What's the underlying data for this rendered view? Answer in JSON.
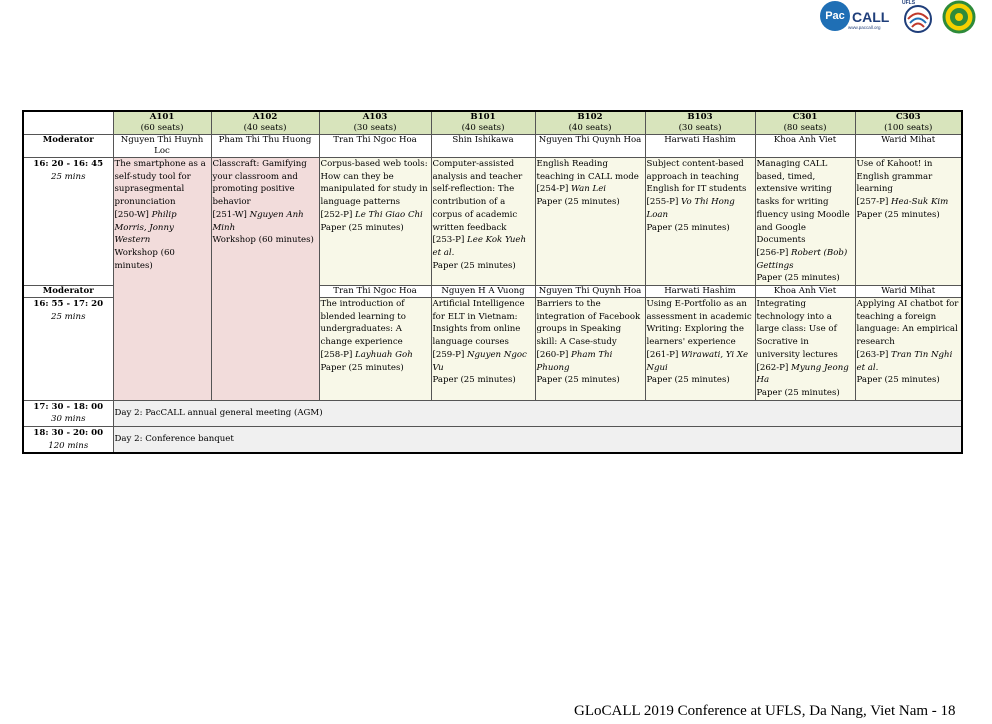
{
  "logos": {
    "paccall_badge": "Pac",
    "paccall_text": "CALL",
    "paccall_url": "www.paccall.org",
    "ufls_label": "UFLS"
  },
  "rooms": [
    {
      "name": "A101",
      "seats": "(60 seats)"
    },
    {
      "name": "A102",
      "seats": "(40 seats)"
    },
    {
      "name": "A103",
      "seats": "(30 seats)"
    },
    {
      "name": "B101",
      "seats": "(40 seats)"
    },
    {
      "name": "B102",
      "seats": "(40 seats)"
    },
    {
      "name": "B103",
      "seats": "(30 seats)"
    },
    {
      "name": "C301",
      "seats": "(80 seats)"
    },
    {
      "name": "C303",
      "seats": "(100 seats)"
    }
  ],
  "moderator_label": "Moderator",
  "session1": {
    "time": "16: 20 - 16: 45",
    "duration": "25 mins",
    "moderators": [
      "Nguyen Thi Huynh Loc",
      "Pham Thi Thu Huong",
      "Tran Thi Ngoc Hoa",
      "Shin Ishikawa",
      "Nguyen Thi Quynh Hoa",
      "Harwati Hashim",
      "Khoa Anh Viet",
      "Warid Mihat"
    ],
    "cells": [
      {
        "title": "The smartphone as a self-study tool for suprasegmental pronunciation",
        "code": "[250-W]",
        "authors": "Philip Morris, Jonny Western",
        "type": "Workshop (60 minutes)"
      },
      {
        "title": "Classcraft: Gamifying your classroom and promoting positive behavior",
        "code": "[251-W]",
        "authors": "Nguyen Anh Minh",
        "type": "Workshop (60 minutes)"
      },
      {
        "title": "Corpus-based web tools: How can they be manipulated for study in language patterns",
        "code": "[252-P]",
        "authors": "Le Thi Giao Chi",
        "type": "Paper (25 minutes)"
      },
      {
        "title": "Computer-assisted analysis and teacher self-reflection: The contribution of a corpus of academic written feedback",
        "code": "[253-P]",
        "authors": "Lee Kok Yueh et al.",
        "type": "Paper (25 minutes)"
      },
      {
        "title": "English Reading teaching in CALL mode",
        "code": "[254-P]",
        "authors": "Wan Lei",
        "type": "Paper (25 minutes)"
      },
      {
        "title": "Subject content-based approach in teaching English for IT students",
        "code": "[255-P]",
        "authors": "Vo Thi Hong Loan",
        "type": "Paper (25 minutes)"
      },
      {
        "title": "Managing CALL based, timed, extensive writing tasks for writing fluency using Moodle and Google Documents",
        "code": "[256-P]",
        "authors": "Robert (Bob) Gettings",
        "type": "Paper (25 minutes)"
      },
      {
        "title": "Use of Kahoot! in English grammar learning",
        "code": "[257-P]",
        "authors": "Hea-Suk Kim",
        "type": "Paper (25 minutes)"
      }
    ]
  },
  "session2": {
    "time": "16: 55 - 17: 20",
    "duration": "25 mins",
    "moderators": [
      "Tran Thi Ngoc Hoa",
      "Nguyen H A Vuong",
      "Nguyen Thi Quynh Hoa",
      "Harwati Hashim",
      "Khoa Anh Viet",
      "Warid Mihat"
    ],
    "cells": [
      {
        "title": "The introduction of blended learning to undergraduates: A change experience",
        "code": "[258-P]",
        "authors": "Layhuah Goh",
        "type": "Paper (25 minutes)"
      },
      {
        "title": "Artificial Intelligence for ELT in Vietnam: Insights from online language courses",
        "code": "[259-P]",
        "authors": "Nguyen Ngoc Vu",
        "type": "Paper (25 minutes)"
      },
      {
        "title": "Barriers to the integration of Facebook groups in Speaking skill: A Case-study",
        "code": "[260-P]",
        "authors": "Pham Thi Phuong",
        "type": "Paper (25 minutes)"
      },
      {
        "title": "Using E-Portfolio as an assessment in academic Writing: Exploring the learners' experience",
        "code": "[261-P]",
        "authors": "Wirawati, Yi Xe Ngui",
        "type": "Paper (25 minutes)"
      },
      {
        "title": "Integrating technology into a large class: Use of Socrative in university lectures",
        "code": "[262-P]",
        "authors": "Myung Jeong Ha",
        "type": "Paper (25 minutes)"
      },
      {
        "title": "Applying AI chatbot for teaching a foreign language: An empirical research",
        "code": "[263-P]",
        "authors": "Tran Tin Nghi et al.",
        "type": "Paper (25 minutes)"
      }
    ]
  },
  "agm": {
    "time": "17: 30 - 18: 00",
    "duration": "30 mins",
    "text": "Day 2: PacCALL annual general meeting (AGM)"
  },
  "banquet": {
    "time": "18: 30 - 20: 00",
    "duration": "120 mins",
    "text": "Day 2: Conference banquet"
  },
  "footer": "GLoCALL 2019 Conference at UFLS, Da Nang, Viet Nam - 18",
  "colors": {
    "header_green": "#d8e4bc",
    "workshop_pink": "#f2dcdb",
    "paper_cream": "#f8f8e8",
    "event_grey": "#f0f0f0"
  }
}
